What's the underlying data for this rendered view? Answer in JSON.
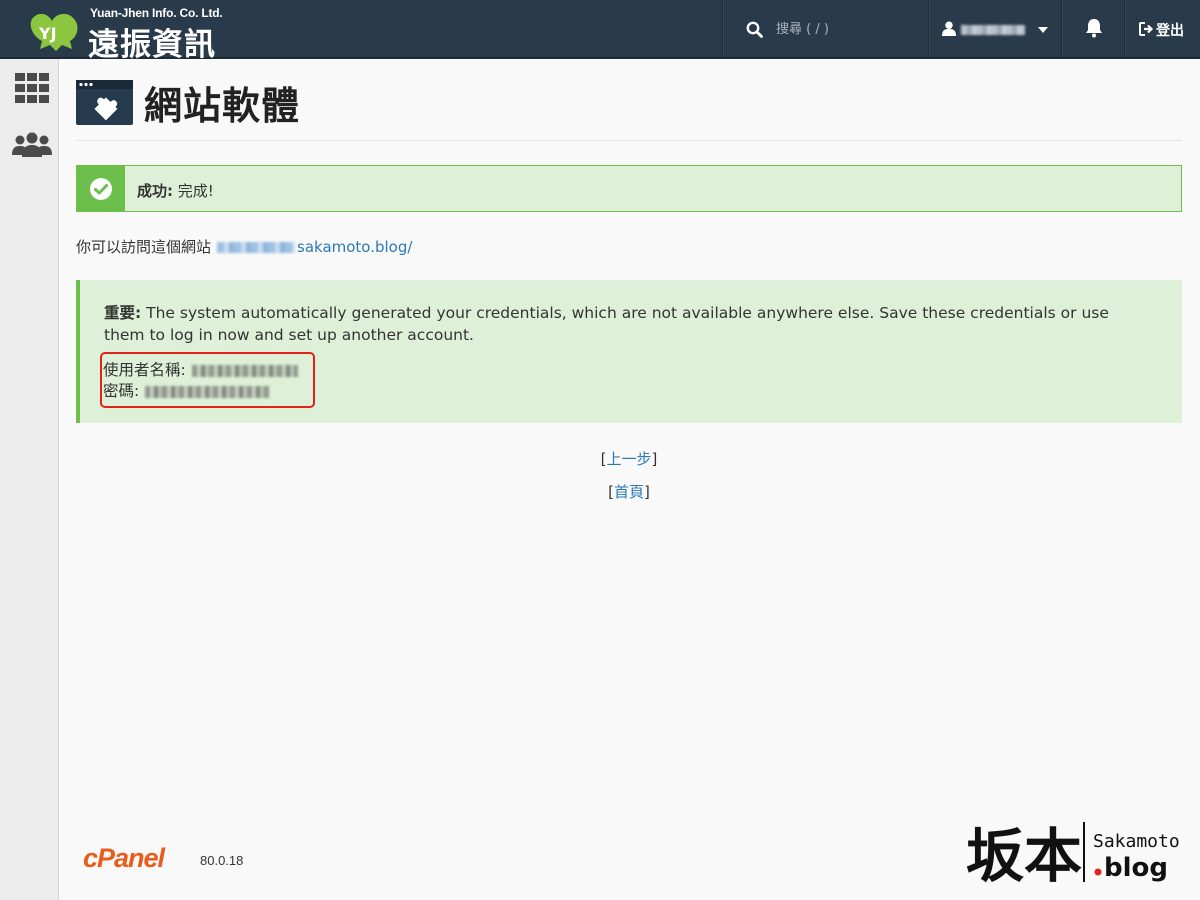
{
  "header": {
    "logo_en": "Yuan-Jhen Info. Co. Ltd.",
    "logo_zh": "遠振資訊",
    "search_placeholder": "搜尋 ( / )",
    "logout_label": "登出"
  },
  "main": {
    "title": "網站軟體",
    "success_label": "成功:",
    "success_message": "完成!",
    "visit_prefix": "你可以訪問這個網站",
    "visit_domain": "sakamoto.blog/",
    "important_label": "重要:",
    "important_message": "The system automatically generated your credentials, which are not available anywhere else. Save these credentials or use them to log in now and set up another account.",
    "username_label": "使用者名稱:",
    "password_label": "密碼:",
    "back_link": "上一步",
    "home_link": "首頁"
  },
  "footer": {
    "cpanel": "cPanel",
    "version": "80.0.18"
  },
  "watermark": {
    "zh": "坂本",
    "en": "Sakamoto",
    "blog": ".blog"
  },
  "colors": {
    "topbar": "#293a4a",
    "success_green": "#6cbf4a",
    "alert_bg": "#dff0d8",
    "link_blue": "#2a7ab8",
    "highlight_red": "#e2231a",
    "cpanel_orange": "#e95d1b"
  }
}
